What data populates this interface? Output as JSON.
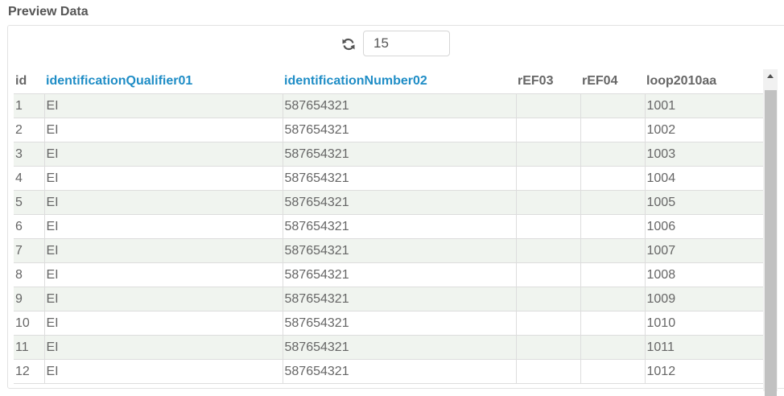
{
  "title": "Preview Data",
  "toolbar": {
    "refresh_icon": "refresh-icon",
    "rows_value": "15"
  },
  "table": {
    "columns": [
      "id",
      "identificationQualifier01",
      "identificationNumber02",
      "rEF03",
      "rEF04",
      "loop2010aa"
    ],
    "rows": [
      [
        "1",
        "EI",
        "587654321",
        "",
        "",
        "1001"
      ],
      [
        "2",
        "EI",
        "587654321",
        "",
        "",
        "1002"
      ],
      [
        "3",
        "EI",
        "587654321",
        "",
        "",
        "1003"
      ],
      [
        "4",
        "EI",
        "587654321",
        "",
        "",
        "1004"
      ],
      [
        "5",
        "EI",
        "587654321",
        "",
        "",
        "1005"
      ],
      [
        "6",
        "EI",
        "587654321",
        "",
        "",
        "1006"
      ],
      [
        "7",
        "EI",
        "587654321",
        "",
        "",
        "1007"
      ],
      [
        "8",
        "EI",
        "587654321",
        "",
        "",
        "1008"
      ],
      [
        "9",
        "EI",
        "587654321",
        "",
        "",
        "1009"
      ],
      [
        "10",
        "EI",
        "587654321",
        "",
        "",
        "1010"
      ],
      [
        "11",
        "EI",
        "587654321",
        "",
        "",
        "1011"
      ],
      [
        "12",
        "EI",
        "587654321",
        "",
        "",
        "1012"
      ]
    ]
  },
  "colors": {
    "link_header": "#1f8dc6",
    "row_stripe": "#f0f4ef",
    "text": "#666666"
  }
}
